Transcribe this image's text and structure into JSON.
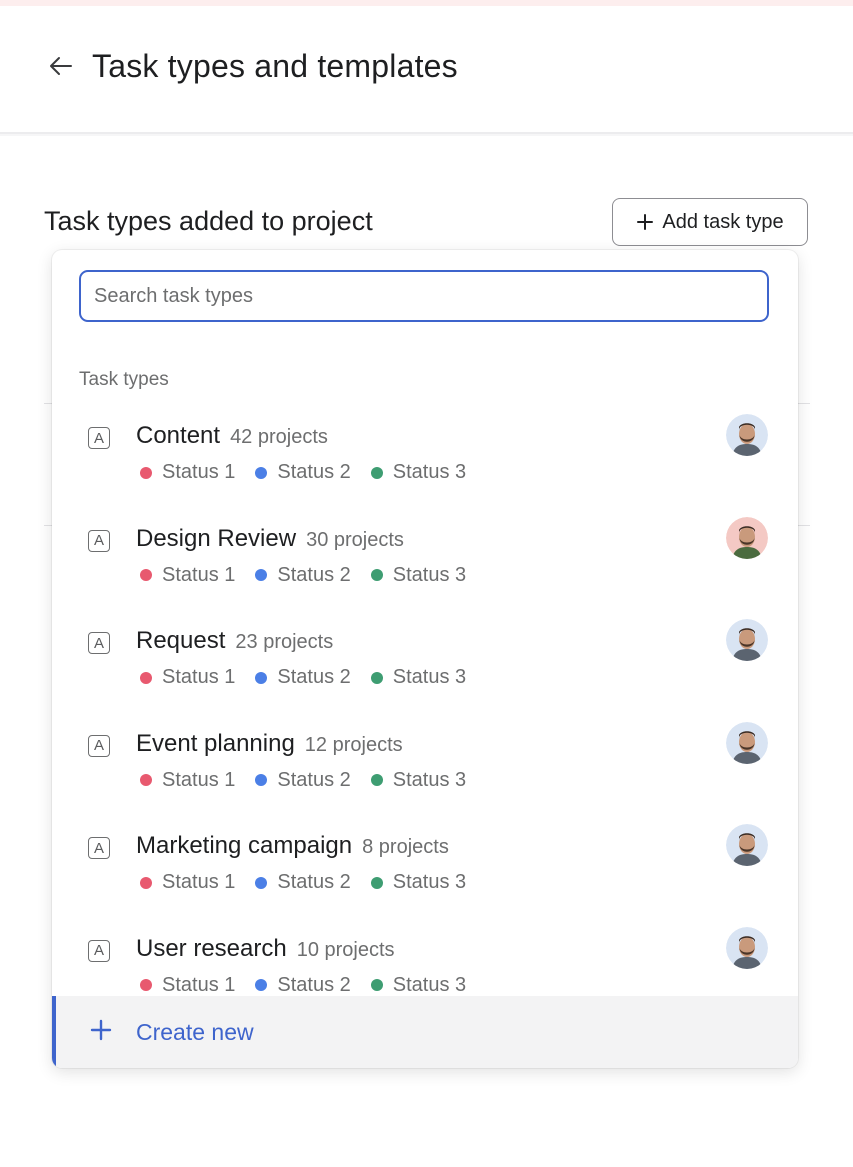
{
  "header": {
    "title": "Task types and templates"
  },
  "section": {
    "title": "Task types added to project",
    "add_button_label": "Add task type"
  },
  "dropdown": {
    "search_placeholder": "Search task types",
    "group_label": "Task types",
    "items": [
      {
        "name": "Content",
        "count": "42 projects",
        "statuses": [
          "Status 1",
          "Status 2",
          "Status 3"
        ],
        "avatar": "avatar-man-beard"
      },
      {
        "name": "Design Review",
        "count": "30 projects",
        "statuses": [
          "Status 1",
          "Status 2",
          "Status 3"
        ],
        "avatar": "avatar-man-pink"
      },
      {
        "name": "Request",
        "count": "23 projects",
        "statuses": [
          "Status 1",
          "Status 2",
          "Status 3"
        ],
        "avatar": "avatar-man-beard"
      },
      {
        "name": "Event planning",
        "count": "12 projects",
        "statuses": [
          "Status 1",
          "Status 2",
          "Status 3"
        ],
        "avatar": "avatar-man-beard"
      },
      {
        "name": "Marketing campaign",
        "count": "8 projects",
        "statuses": [
          "Status 1",
          "Status 2",
          "Status 3"
        ],
        "avatar": "avatar-man-beard"
      },
      {
        "name": "User research",
        "count": "10 projects",
        "statuses": [
          "Status 1",
          "Status 2",
          "Status 3"
        ],
        "avatar": "avatar-man-beard"
      }
    ],
    "type_icon_glyph": "A",
    "create_new_label": "Create new"
  },
  "colors": {
    "accent": "#3e64cc",
    "status_1": "#e8596f",
    "status_2": "#4b7fe6",
    "status_3": "#3e9d72"
  }
}
